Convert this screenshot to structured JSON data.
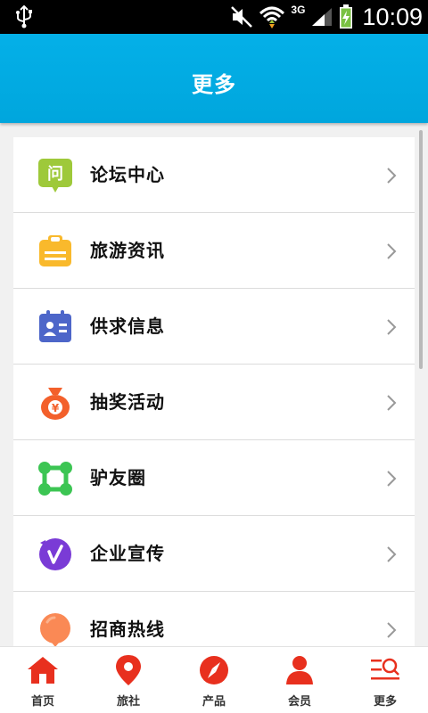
{
  "status_bar": {
    "network": "3G",
    "time": "10:09"
  },
  "header": {
    "title": "更多"
  },
  "menu": {
    "items": [
      {
        "label": "论坛中心",
        "icon": "forum-question-icon",
        "color": "#9ec93a",
        "glyph": "问"
      },
      {
        "label": "旅游资讯",
        "icon": "ticket-icon",
        "color": "#f9b92c"
      },
      {
        "label": "供求信息",
        "icon": "contact-card-icon",
        "color": "#4d66c9"
      },
      {
        "label": "抽奖活动",
        "icon": "money-bag-icon",
        "color": "#f3602b",
        "glyph": "¥"
      },
      {
        "label": "驴友圈",
        "icon": "friends-network-icon",
        "color": "#3cc553"
      },
      {
        "label": "企业宣传",
        "icon": "company-promo-icon",
        "color": "#7a3bd6"
      },
      {
        "label": "招商热线",
        "icon": "balloon-icon",
        "color": "#fa8955"
      }
    ]
  },
  "bottom_nav": {
    "accent_color": "#e8301e",
    "items": [
      {
        "label": "首页",
        "icon": "home-icon"
      },
      {
        "label": "旅社",
        "icon": "location-pin-icon"
      },
      {
        "label": "产品",
        "icon": "compass-icon"
      },
      {
        "label": "会员",
        "icon": "user-icon"
      },
      {
        "label": "更多",
        "icon": "more-search-icon"
      }
    ]
  }
}
